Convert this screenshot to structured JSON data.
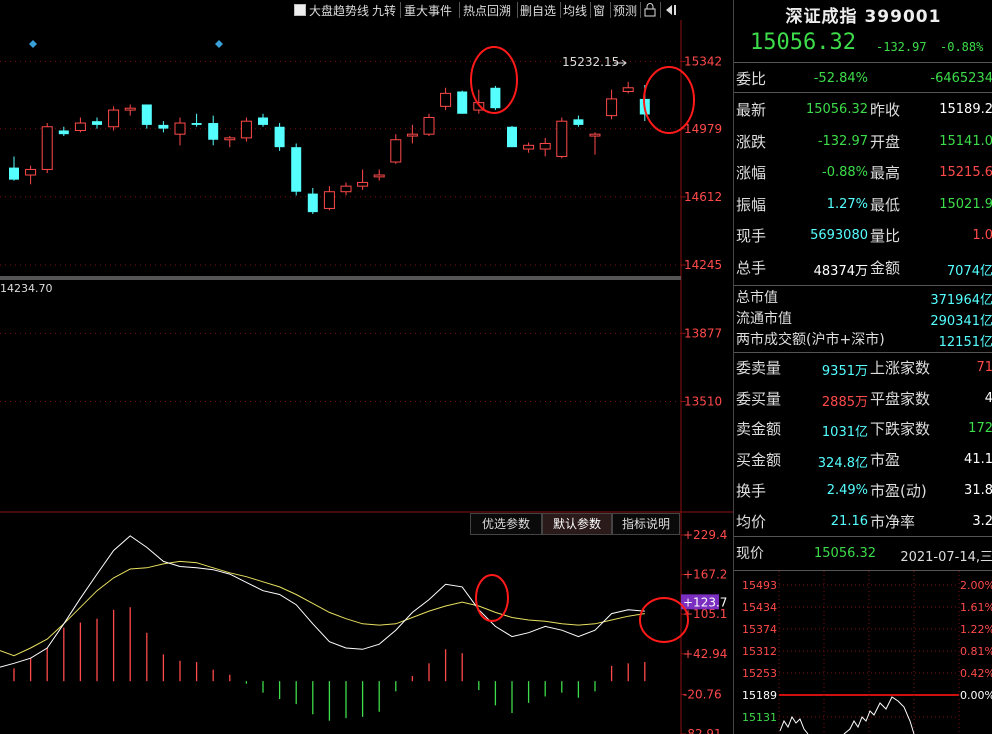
{
  "toolbar": {
    "items": [
      "大盘趋势线",
      "九转",
      "重大事件",
      "热点回溯",
      "删自选",
      "均线",
      "窗",
      "预测"
    ]
  },
  "chart_data": [
    {
      "type": "candlestick",
      "price_ticks": [
        "15342",
        "14979",
        "14612",
        "14245",
        "13877",
        "13510"
      ],
      "ylim": [
        13297,
        15452
      ],
      "high_label": "15232.15",
      "low_label": "14234.70",
      "colors": {
        "up": "#ff4a4a",
        "down": "#55ffff"
      },
      "candles": [
        {
          "o": 14770,
          "h": 14830,
          "l": 14700,
          "c": 14705
        },
        {
          "o": 14730,
          "h": 14780,
          "l": 14680,
          "c": 14760
        },
        {
          "o": 14760,
          "h": 15010,
          "l": 14740,
          "c": 14990
        },
        {
          "o": 14970,
          "h": 14990,
          "l": 14940,
          "c": 14950
        },
        {
          "o": 14970,
          "h": 15040,
          "l": 14960,
          "c": 15010
        },
        {
          "o": 15020,
          "h": 15040,
          "l": 14980,
          "c": 15000
        },
        {
          "o": 14990,
          "h": 15100,
          "l": 14970,
          "c": 15080
        },
        {
          "o": 15080,
          "h": 15110,
          "l": 15050,
          "c": 15090
        },
        {
          "o": 15110,
          "h": 15110,
          "l": 14980,
          "c": 15000
        },
        {
          "o": 15000,
          "h": 15020,
          "l": 14960,
          "c": 14980
        },
        {
          "o": 14950,
          "h": 15040,
          "l": 14890,
          "c": 15010
        },
        {
          "o": 15010,
          "h": 15060,
          "l": 14990,
          "c": 15000
        },
        {
          "o": 15010,
          "h": 15050,
          "l": 14890,
          "c": 14920
        },
        {
          "o": 14920,
          "h": 14940,
          "l": 14880,
          "c": 14930
        },
        {
          "o": 14930,
          "h": 15040,
          "l": 14910,
          "c": 15020
        },
        {
          "o": 15040,
          "h": 15060,
          "l": 14990,
          "c": 15000
        },
        {
          "o": 14990,
          "h": 15010,
          "l": 14860,
          "c": 14880
        },
        {
          "o": 14880,
          "h": 14900,
          "l": 14620,
          "c": 14640
        },
        {
          "o": 14630,
          "h": 14660,
          "l": 14520,
          "c": 14530
        },
        {
          "o": 14550,
          "h": 14670,
          "l": 14540,
          "c": 14640
        },
        {
          "o": 14640,
          "h": 14690,
          "l": 14620,
          "c": 14670
        },
        {
          "o": 14670,
          "h": 14760,
          "l": 14650,
          "c": 14690
        },
        {
          "o": 14720,
          "h": 14760,
          "l": 14700,
          "c": 14730
        },
        {
          "o": 14800,
          "h": 14950,
          "l": 14790,
          "c": 14920
        },
        {
          "o": 14940,
          "h": 15000,
          "l": 14900,
          "c": 14950
        },
        {
          "o": 14950,
          "h": 15060,
          "l": 14940,
          "c": 15040
        },
        {
          "o": 15100,
          "h": 15200,
          "l": 15080,
          "c": 15170
        },
        {
          "o": 15180,
          "h": 15185,
          "l": 15060,
          "c": 15060
        },
        {
          "o": 15080,
          "h": 15190,
          "l": 15060,
          "c": 15120
        },
        {
          "o": 15200,
          "h": 15210,
          "l": 15080,
          "c": 15090
        },
        {
          "o": 14990,
          "h": 14995,
          "l": 14880,
          "c": 14880
        },
        {
          "o": 14870,
          "h": 14905,
          "l": 14850,
          "c": 14890
        },
        {
          "o": 14870,
          "h": 14930,
          "l": 14830,
          "c": 14900
        },
        {
          "o": 14830,
          "h": 15040,
          "l": 14820,
          "c": 15020
        },
        {
          "o": 15030,
          "h": 15050,
          "l": 14990,
          "c": 15000
        },
        {
          "o": 14940,
          "h": 14960,
          "l": 14840,
          "c": 14950
        },
        {
          "o": 15050,
          "h": 15190,
          "l": 15030,
          "c": 15140
        },
        {
          "o": 15180,
          "h": 15232,
          "l": 15170,
          "c": 15200
        },
        {
          "o": 15140,
          "h": 15215,
          "l": 15021,
          "c": 15056
        }
      ]
    },
    {
      "type": "macd",
      "ticks": [
        "+229.4",
        "+167.2",
        "+105.1",
        "+42.94",
        "-20.76",
        "-82.91"
      ],
      "ylim": [
        -82.91,
        229.4
      ],
      "current_label": "+123.7",
      "dif": [
        28,
        36,
        52,
        90,
        130,
        168,
        205,
        228,
        210,
        188,
        180,
        178,
        175,
        168,
        155,
        142,
        136,
        120,
        90,
        62,
        52,
        50,
        58,
        80,
        108,
        128,
        152,
        148,
        112,
        86,
        70,
        76,
        86,
        80,
        70,
        80,
        106,
        112,
        110
      ],
      "dea": [
        40,
        52,
        66,
        90,
        116,
        142,
        162,
        176,
        178,
        184,
        188,
        186,
        178,
        170,
        164,
        156,
        148,
        136,
        122,
        108,
        98,
        90,
        88,
        90,
        100,
        110,
        118,
        124,
        118,
        108,
        100,
        96,
        94,
        90,
        88,
        90,
        96,
        102,
        106
      ],
      "hist": [
        20,
        36,
        52,
        84,
        92,
        98,
        112,
        116,
        76,
        42,
        32,
        30,
        18,
        10,
        -4,
        -18,
        -28,
        -36,
        -52,
        -62,
        -58,
        -56,
        -48,
        -16,
        8,
        28,
        50,
        44,
        -14,
        -38,
        -50,
        -34,
        -24,
        -18,
        -26,
        -16,
        24,
        28,
        30
      ]
    }
  ],
  "macd_buttons": [
    "优选参数",
    "默认参数",
    "指标说明"
  ],
  "quote": {
    "title": "深证成指 399001",
    "price": "15056.32",
    "change": "-132.97",
    "change_pct": "-0.88%",
    "weibi_label": "委比",
    "weibi_pct": "-52.84%",
    "weibi_val": "-6465234",
    "rows": [
      {
        "l1": "最新",
        "v1": "15056.32",
        "c1": "#3ddc4a",
        "l2": "昨收",
        "v2": "15189.2",
        "c2": "#ffffff"
      },
      {
        "l1": "涨跌",
        "v1": "-132.97",
        "c1": "#3ddc4a",
        "l2": "开盘",
        "v2": "15141.0",
        "c2": "#3ddc4a"
      },
      {
        "l1": "涨幅",
        "v1": "-0.88%",
        "c1": "#3ddc4a",
        "l2": "最高",
        "v2": "15215.6",
        "c2": "#ff4a4a"
      },
      {
        "l1": "振幅",
        "v1": "1.27%",
        "c1": "#55ffff",
        "l2": "最低",
        "v2": "15021.9",
        "c2": "#3ddc4a"
      },
      {
        "l1": "现手",
        "v1": "5693080",
        "c1": "#55ffff",
        "l2": "量比",
        "v2": "1.0",
        "c2": "#ff4a4a"
      },
      {
        "l1": "总手",
        "v1": "48374万",
        "c1": "#ffffff",
        "l2": "金额",
        "v2": "7074亿",
        "c2": "#55ffff"
      }
    ],
    "wide_rows": [
      {
        "l": "总市值",
        "v": "371964亿"
      },
      {
        "l": "流通市值",
        "v": "290341亿"
      },
      {
        "l": "两市成交额(沪市+深市)",
        "v": "12151亿"
      }
    ],
    "rows2": [
      {
        "l1": "委卖量",
        "v1": "9351万",
        "c1": "#55ffff",
        "l2": "上涨家数",
        "v2": "71",
        "c2": "#ff4a4a"
      },
      {
        "l1": "委买量",
        "v1": "2885万",
        "c1": "#ff4a4a",
        "l2": "平盘家数",
        "v2": "4",
        "c2": "#ffffff"
      },
      {
        "l1": "卖金额",
        "v1": "1031亿",
        "c1": "#55ffff",
        "l2": "下跌家数",
        "v2": "172",
        "c2": "#3ddc4a"
      },
      {
        "l1": "买金额",
        "v1": "324.8亿",
        "c1": "#55ffff",
        "l2": "市盈",
        "v2": "41.1",
        "c2": "#ffffff"
      },
      {
        "l1": "换手",
        "v1": "2.49%",
        "c1": "#55ffff",
        "l2": "市盈(动)",
        "v2": "31.8",
        "c2": "#ffffff"
      },
      {
        "l1": "均价",
        "v1": "21.16",
        "c1": "#55ffff",
        "l2": "市净率",
        "v2": "3.2",
        "c2": "#ffffff"
      }
    ],
    "now_label": "现价",
    "now_price": "15056.32",
    "now_date": "2021-07-14,三"
  },
  "intraday": {
    "price_ticks": [
      "15493",
      "15434",
      "15374",
      "15312",
      "15253",
      "15189",
      "15131"
    ],
    "pct_ticks": [
      "2.00%",
      "1.61%",
      "1.22%",
      "0.81%",
      "0.42%",
      "0.00%"
    ]
  }
}
